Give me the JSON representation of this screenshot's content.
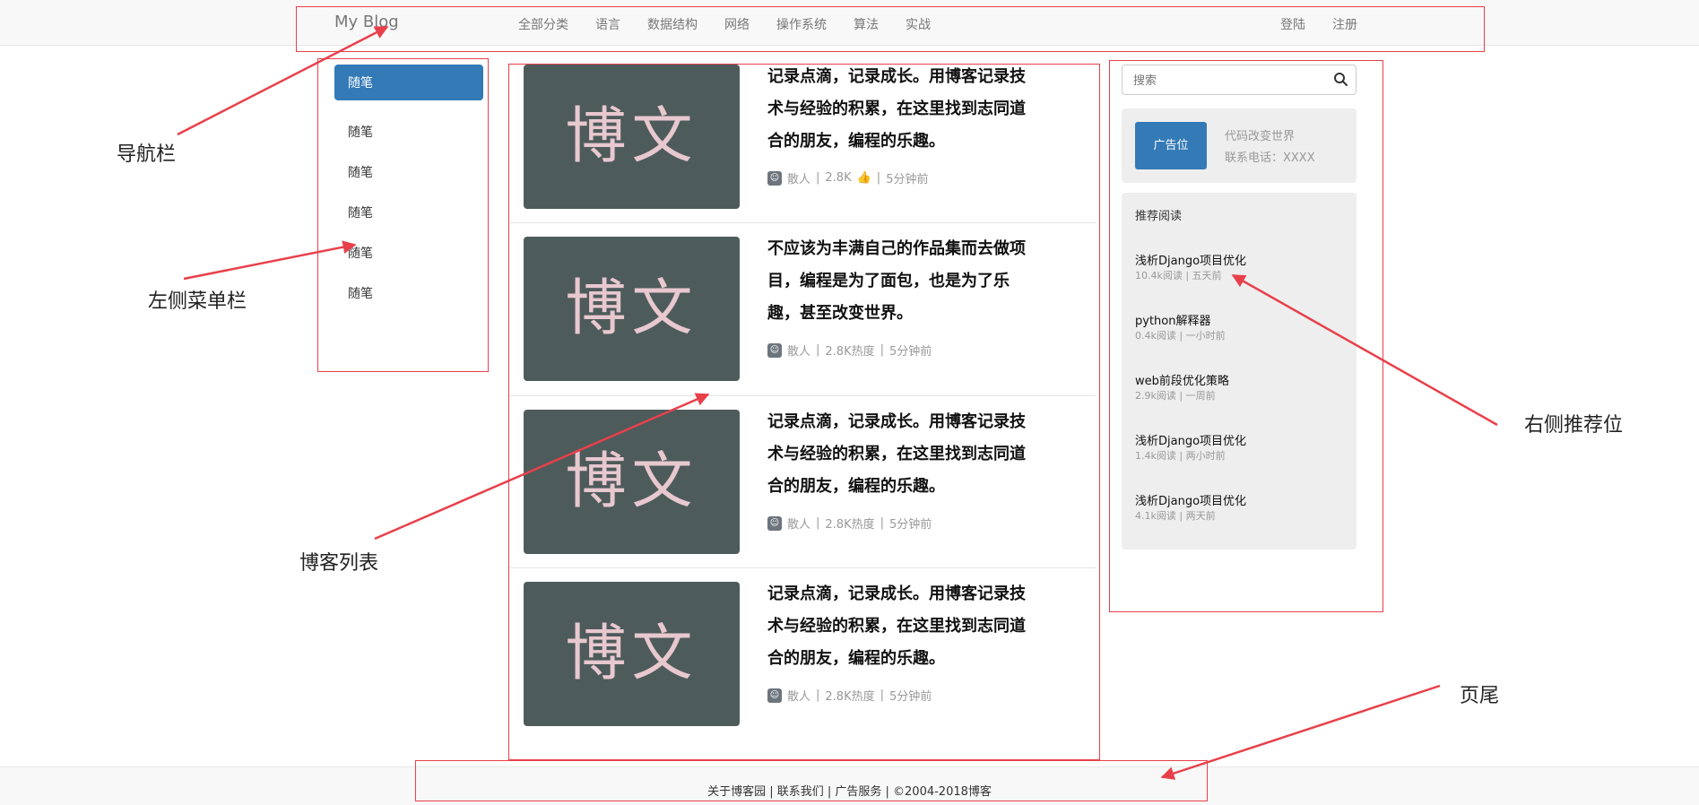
{
  "navbar": {
    "brand": "My Blog",
    "items": [
      {
        "label": "全部分类"
      },
      {
        "label": "语言"
      },
      {
        "label": "数据结构"
      },
      {
        "label": "网络"
      },
      {
        "label": "操作系统"
      },
      {
        "label": "算法"
      },
      {
        "label": "实战"
      }
    ],
    "login": "登陆",
    "register": "注册"
  },
  "left_menu": {
    "items": [
      {
        "label": "随笔",
        "active": true
      },
      {
        "label": "随笔"
      },
      {
        "label": "随笔"
      },
      {
        "label": "随笔"
      },
      {
        "label": "随笔"
      },
      {
        "label": "随笔"
      }
    ]
  },
  "blog_list": [
    {
      "thumb_text": "博文",
      "title": "记录点滴，记录成长。用博客记录技术与经验的积累，在这里找到志同道合的朋友，编程的乐趣。",
      "author": "散人",
      "stat": "2.8K",
      "stat_suffix": "",
      "time": "5分钟前",
      "show_like_icon": true
    },
    {
      "thumb_text": "博文",
      "title": "不应该为丰满自己的作品集而去做项目，编程是为了面包，也是为了乐趣，甚至改变世界。",
      "author": "散人",
      "stat": "2.8K热度",
      "time": "5分钟前",
      "show_like_icon": false
    },
    {
      "thumb_text": "博文",
      "title": "记录点滴，记录成长。用博客记录技术与经验的积累，在这里找到志同道合的朋友，编程的乐趣。",
      "author": "散人",
      "stat": "2.8K热度",
      "time": "5分钟前",
      "show_like_icon": false
    },
    {
      "thumb_text": "博文",
      "title": "记录点滴，记录成长。用博客记录技术与经验的积累，在这里找到志同道合的朋友，编程的乐趣。",
      "author": "散人",
      "stat": "2.8K热度",
      "time": "5分钟前",
      "show_like_icon": false
    }
  ],
  "sidebar": {
    "search_placeholder": "搜索",
    "ad": {
      "button": "广告位",
      "slogan": "代码改变世界",
      "phone": "联系电话：XXXX"
    },
    "recommend": {
      "title": "推荐阅读",
      "items": [
        {
          "title": "浅析Django项目优化",
          "meta": "10.4k阅读 | 五天前"
        },
        {
          "title": "python解释器",
          "meta": "0.4k阅读 | 一小时前"
        },
        {
          "title": "web前段优化策略",
          "meta": "2.9k阅读 | 一周前"
        },
        {
          "title": "浅析Django项目优化",
          "meta": "1.4k阅读 | 两小时前"
        },
        {
          "title": "浅析Django项目优化",
          "meta": "4.1k阅读 | 两天前"
        }
      ]
    }
  },
  "footer": {
    "text": "关于博客园 | 联系我们 | 广告服务 | ©2004-2018博客"
  },
  "annotations": {
    "navbar": "导航栏",
    "left_menu": "左侧菜单栏",
    "blog_list": "博客列表",
    "right": "右侧推荐位",
    "footer": "页尾"
  },
  "colors": {
    "accent": "#337ab7",
    "annotation_red": "#e8404a",
    "thumb_bg": "#4e5b5b"
  }
}
